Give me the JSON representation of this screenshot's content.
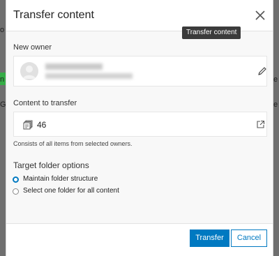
{
  "background": {
    "left_fragments": [
      "o",
      "n",
      "G"
    ],
    "right_fragments": [
      "e",
      "e"
    ]
  },
  "dialog": {
    "title": "Transfer content",
    "close_tooltip": "Transfer content",
    "new_owner": {
      "label": "New owner"
    },
    "content": {
      "label": "Content to transfer",
      "count": "46",
      "description": "Consists of all items from selected owners."
    },
    "folder_options": {
      "label": "Target folder options",
      "options": [
        {
          "label": "Maintain folder structure",
          "selected": true
        },
        {
          "label": "Select one folder for all content",
          "selected": false
        }
      ]
    },
    "buttons": {
      "transfer": "Transfer",
      "cancel": "Cancel"
    }
  },
  "colors": {
    "accent": "#0079c1",
    "overlay": "#6f6f6f",
    "bg_green": "#35ac46"
  }
}
